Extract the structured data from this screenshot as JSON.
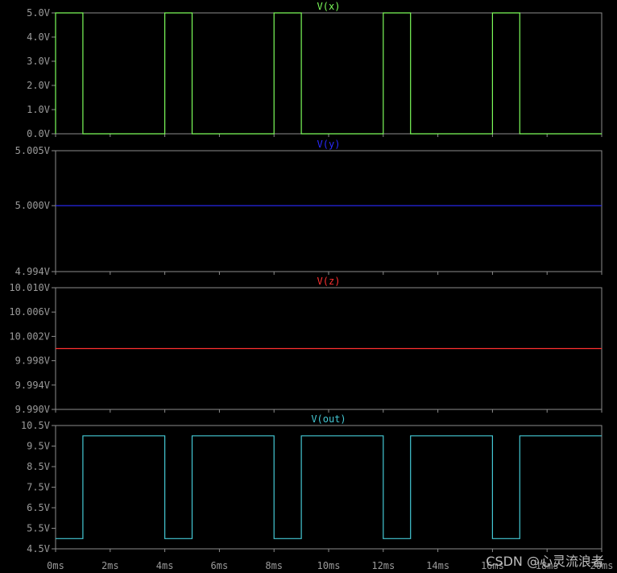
{
  "watermark": "CSDN @心灵流浪者",
  "chart_data": [
    {
      "type": "line",
      "title": "V(x)",
      "color": "#7cfc5a",
      "ylim": [
        0,
        5
      ],
      "y_ticks": [
        "0.0V",
        "1.0V",
        "2.0V",
        "3.0V",
        "4.0V",
        "5.0V"
      ],
      "x": [
        0,
        0,
        1,
        1,
        4,
        4,
        5,
        5,
        8,
        8,
        9,
        9,
        12,
        12,
        13,
        13,
        16,
        16,
        17,
        17,
        20
      ],
      "y": [
        0,
        5,
        5,
        0,
        0,
        5,
        5,
        0,
        0,
        5,
        5,
        0,
        0,
        5,
        5,
        0,
        0,
        5,
        5,
        0,
        0
      ]
    },
    {
      "type": "line",
      "title": "V(y)",
      "color": "#2a2aff",
      "ylim": [
        4.994,
        5.005
      ],
      "y_ticks": [
        "4.994V",
        "5.000V",
        "5.005V"
      ],
      "y_tick_values": [
        4.994,
        5.0,
        5.005
      ],
      "x": [
        0,
        20
      ],
      "y": [
        5.0,
        5.0
      ]
    },
    {
      "type": "line",
      "title": "V(z)",
      "color": "#ff3030",
      "ylim": [
        9.99,
        10.01
      ],
      "y_ticks": [
        "9.990V",
        "9.994V",
        "9.998V",
        "10.002V",
        "10.006V",
        "10.010V"
      ],
      "x": [
        0,
        20
      ],
      "y": [
        10.0,
        10.0
      ]
    },
    {
      "type": "line",
      "title": "V(out)",
      "color": "#44c8d4",
      "ylim": [
        4.5,
        10.5
      ],
      "y_ticks": [
        "4.5V",
        "5.5V",
        "6.5V",
        "7.5V",
        "8.5V",
        "9.5V",
        "10.5V"
      ],
      "x": [
        0,
        1,
        1,
        4,
        4,
        5,
        5,
        8,
        8,
        9,
        9,
        12,
        12,
        13,
        13,
        16,
        16,
        17,
        17,
        20
      ],
      "y": [
        5,
        5,
        10,
        10,
        5,
        5,
        10,
        10,
        5,
        5,
        10,
        10,
        5,
        5,
        10,
        10,
        5,
        5,
        10,
        10
      ]
    }
  ],
  "x_axis": {
    "xlim": [
      0,
      20
    ],
    "tick_values": [
      0,
      2,
      4,
      6,
      8,
      10,
      12,
      14,
      16,
      18,
      20
    ],
    "tick_labels": [
      "0ms",
      "2ms",
      "4ms",
      "6ms",
      "8ms",
      "10ms",
      "12ms",
      "14ms",
      "16ms",
      "18ms",
      "20ms"
    ]
  }
}
